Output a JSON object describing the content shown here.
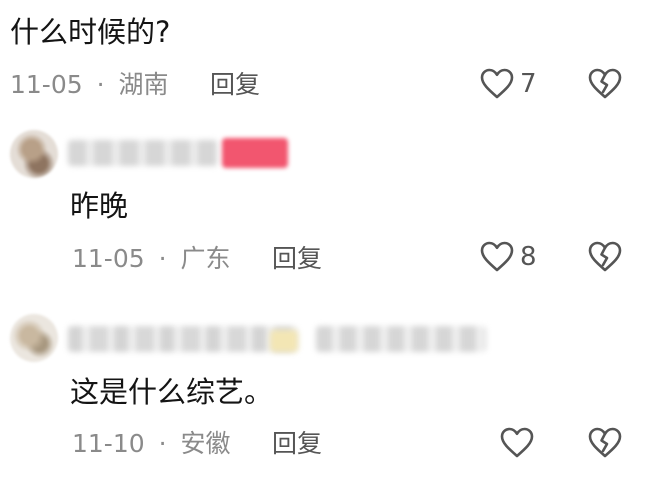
{
  "comments": [
    {
      "text": "什么时候的?",
      "date": "11-05",
      "dot": "·",
      "location": "湖南",
      "reply_label": "回复",
      "likes": "7"
    },
    {
      "text": "昨晚",
      "date": "11-05",
      "dot": "·",
      "location": "广东",
      "reply_label": "回复",
      "likes": "8"
    },
    {
      "text": "这是什么综艺。",
      "date": "11-10",
      "dot": "·",
      "location": "安徽",
      "reply_label": "回复",
      "likes": ""
    }
  ],
  "icons": {
    "like": "heart-icon",
    "dislike": "broken-heart-icon"
  },
  "colors": {
    "text": "#141414",
    "meta": "#8a8a8a",
    "icon": "#555555",
    "badge": "#f0566e"
  }
}
